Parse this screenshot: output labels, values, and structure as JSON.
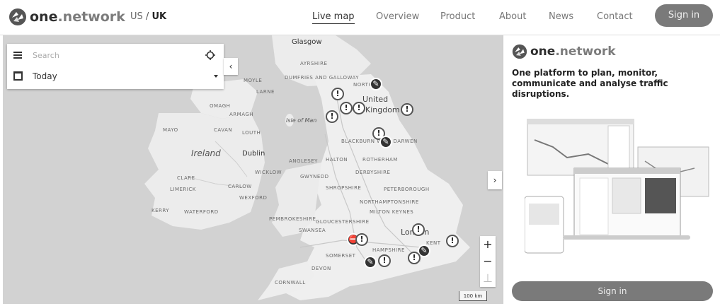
{
  "brand": {
    "one": "one",
    "network": ".network"
  },
  "region": {
    "us": "US",
    "sep": "/",
    "uk": "UK"
  },
  "nav": [
    {
      "label": "Live map",
      "active": true
    },
    {
      "label": "Overview"
    },
    {
      "label": "Product"
    },
    {
      "label": "About"
    },
    {
      "label": "News"
    },
    {
      "label": "Contact"
    }
  ],
  "signin_label": "Sign in",
  "search": {
    "placeholder": "Search",
    "date_value": "Today"
  },
  "map": {
    "labels": {
      "glasgow": "Glasgow",
      "ayrshire": "AYRSHIRE",
      "dumfries": "DUMFRIES AND GALLOWAY",
      "north": "NORTH",
      "united": "United",
      "kingdom": "Kingdom",
      "isle_of_man": "Isle of Man",
      "ireland": "Ireland",
      "dublin": "Dublin",
      "mayo": "MAYO",
      "cavan": "CAVAN",
      "louth": "LOUTH",
      "omagh": "OMAGH",
      "armagh": "ARMAGH",
      "larne": "LARNE",
      "moyle": "MOYLE",
      "clare": "CLARE",
      "limerick": "LIMERICK",
      "kerry": "KERRY",
      "waterford": "WATERFORD",
      "wicklow": "WICKLOW",
      "wexford": "WEXFORD",
      "carlow": "CARLOW",
      "blackburn": "BLACKBURN WITH DARWEN",
      "rotherham": "ROTHERHAM",
      "derbyshire": "DERBYSHIRE",
      "shropshire": "SHROPSHIRE",
      "peterborough": "PETERBOROUGH",
      "northamptonshire": "NORTHAMPTONSHIRE",
      "milton_keynes": "MILTON KEYNES",
      "gloucestershire": "GLOUCESTERSHIRE",
      "somerset": "SOMERSET",
      "devon": "DEVON",
      "cornwall": "CORNWALL",
      "london": "London",
      "halton": "HALTON",
      "anglesey": "ANGLESEY",
      "gwynedd": "GWYNEDD",
      "pembrokeshire": "PEMBROKESHIRE",
      "swansea": "SWANSEA",
      "hampshire": "HAMPSHIRE",
      "kent": "KENT"
    },
    "marker_glyph": "!",
    "zoom_in": "+",
    "zoom_out": "−",
    "reset": "⊥",
    "scale": "100 km",
    "collapse_glyph": "‹",
    "expand_glyph": "›"
  },
  "sidebar": {
    "tagline": "One platform to plan, monitor, communicate and analyse traffic disruptions."
  },
  "colors": {
    "button": "#7a7a7a",
    "sea": "#d2d2d2",
    "land": "#efefef"
  }
}
